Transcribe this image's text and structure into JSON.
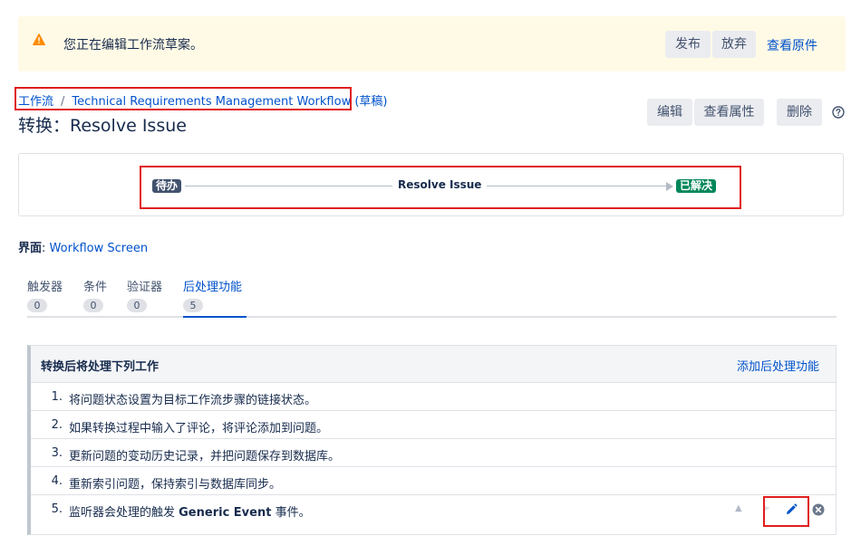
{
  "banner": {
    "message": "您正在编辑工作流草案。",
    "publish_label": "发布",
    "discard_label": "放弃",
    "view_original_label": "查看原件",
    "color": "#fffae6"
  },
  "breadcrumb": {
    "workflows_label": "工作流",
    "separator": "/",
    "workflow_name": "Technical Requirements Management Workflow",
    "draft_suffix": "(草稿)"
  },
  "page": {
    "title": "转换：Resolve Issue"
  },
  "actions": {
    "edit_label": "编辑",
    "view_properties_label": "查看属性",
    "delete_label": "删除",
    "help_icon": "question-circle-icon"
  },
  "diagram": {
    "from_status": "待办",
    "transition_name": "Resolve Issue",
    "to_status": "已解决",
    "from_color": "#42526e",
    "to_color": "#00875a"
  },
  "screen": {
    "label": "界面",
    "colon": ":",
    "name": "Workflow Screen"
  },
  "tabs": [
    {
      "label": "触发器",
      "count": "0"
    },
    {
      "label": "条件",
      "count": "0"
    },
    {
      "label": "验证器",
      "count": "0"
    },
    {
      "label": "后处理功能",
      "count": "5",
      "active": true
    }
  ],
  "post_functions": {
    "header": "转换后将处理下列工作",
    "add_label": "添加后处理功能",
    "items": [
      {
        "num": "1.",
        "text": "将问题状态设置为目标工作流步骤的链接状态。"
      },
      {
        "num": "2.",
        "text": "如果转换过程中输入了评论，将评论添加到问题。"
      },
      {
        "num": "3.",
        "text": "更新问题的变动历史记录，并把问题保存到数据库。"
      },
      {
        "num": "4.",
        "text": "重新索引问题，保持索引与数据库同步。"
      },
      {
        "num": "5.",
        "text_before": "监听器会处理的触发 ",
        "text_bold": "Generic Event",
        "text_after": " 事件。"
      }
    ],
    "row_icons": [
      "arrow-up-icon",
      "arrow-down-icon",
      "pencil-icon",
      "remove-icon"
    ]
  },
  "highlight_color": "#e01e1e"
}
